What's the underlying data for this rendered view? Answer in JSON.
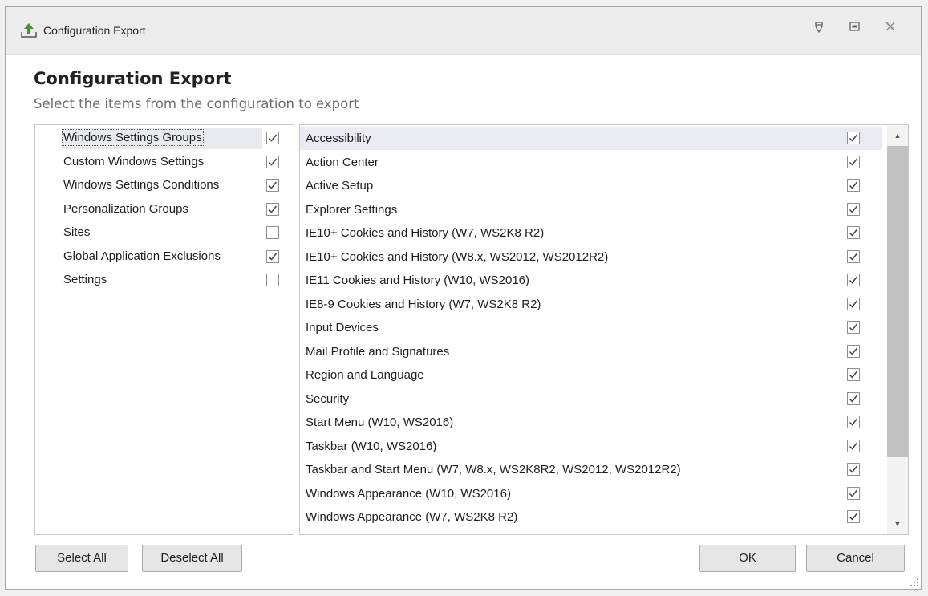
{
  "window": {
    "title": "Configuration Export",
    "accent": "#3a9a2a"
  },
  "header": {
    "title": "Configuration Export",
    "subtitle": "Select the items from the configuration to export"
  },
  "left_list": [
    {
      "label": "Windows Settings Groups",
      "checked": true,
      "selected": true
    },
    {
      "label": "Custom Windows Settings",
      "checked": true
    },
    {
      "label": "Windows Settings Conditions",
      "checked": true
    },
    {
      "label": "Personalization Groups",
      "checked": true
    },
    {
      "label": "Sites",
      "checked": false
    },
    {
      "label": "Global Application Exclusions",
      "checked": true
    },
    {
      "label": "Settings",
      "checked": false
    }
  ],
  "right_list": [
    {
      "label": "Accessibility",
      "checked": true
    },
    {
      "label": "Action Center",
      "checked": true
    },
    {
      "label": "Active Setup",
      "checked": true
    },
    {
      "label": "Explorer Settings",
      "checked": true
    },
    {
      "label": "IE10+ Cookies and History (W7, WS2K8 R2)",
      "checked": true
    },
    {
      "label": "IE10+ Cookies and History (W8.x, WS2012, WS2012R2)",
      "checked": true
    },
    {
      "label": "IE11 Cookies and History (W10, WS2016)",
      "checked": true
    },
    {
      "label": "IE8-9 Cookies and History (W7, WS2K8 R2)",
      "checked": true
    },
    {
      "label": "Input Devices",
      "checked": true
    },
    {
      "label": "Mail Profile and Signatures",
      "checked": true
    },
    {
      "label": "Region and Language",
      "checked": true
    },
    {
      "label": "Security",
      "checked": true
    },
    {
      "label": "Start Menu (W10, WS2016)",
      "checked": true
    },
    {
      "label": "Taskbar (W10, WS2016)",
      "checked": true
    },
    {
      "label": "Taskbar and Start Menu (W7, W8.x, WS2K8R2, WS2012, WS2012R2)",
      "checked": true
    },
    {
      "label": "Windows Appearance (W10, WS2016)",
      "checked": true
    },
    {
      "label": "Windows Appearance (W7, WS2K8 R2)",
      "checked": true
    },
    {
      "label": "",
      "checked": true
    }
  ],
  "buttons": {
    "select_all": "Select All",
    "deselect_all": "Deselect All",
    "ok": "OK",
    "cancel": "Cancel"
  }
}
